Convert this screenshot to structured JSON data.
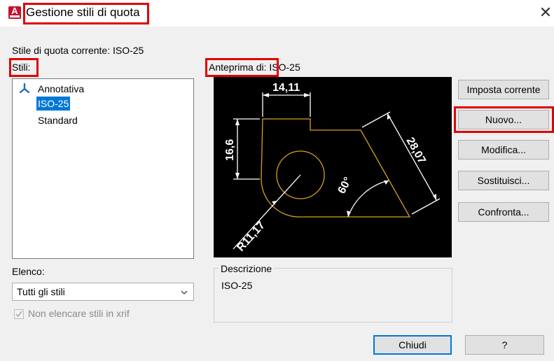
{
  "window": {
    "title": "Gestione stili di quota",
    "close_glyph": "✕",
    "app_icon_letter": "A"
  },
  "current_style_label": "Stile di quota corrente: ISO-25",
  "styles": {
    "label": "Stili:",
    "items": [
      {
        "name": "Annotativa",
        "icon": "annotative-icon",
        "selected": false
      },
      {
        "name": "ISO-25",
        "icon": "",
        "selected": true
      },
      {
        "name": "Standard",
        "icon": "",
        "selected": false
      }
    ]
  },
  "preview": {
    "label": "Anteprima di: ISO-25",
    "dimensions": {
      "top": "14,11",
      "left": "16,6",
      "diagonal": "28,07",
      "angle": "60°",
      "radius": "R11,17"
    },
    "colors": {
      "background": "#000000",
      "geometry": "#d4a21e",
      "dimension": "#ffffff"
    }
  },
  "buttons": {
    "set_current": "Imposta corrente",
    "new": "Nuovo...",
    "modify": "Modifica...",
    "override": "Sostituisci...",
    "compare": "Confronta...",
    "close": "Chiudi",
    "help": "?"
  },
  "list_filter": {
    "label": "Elenco:",
    "selected": "Tutti gli stili"
  },
  "xref_checkbox": {
    "label": "Non elencare stili in xrif",
    "checked": true,
    "enabled": false
  },
  "description": {
    "label": "Descrizione",
    "text": "ISO-25"
  },
  "highlight_color": "#e00000",
  "accent_color": "#0078d7"
}
